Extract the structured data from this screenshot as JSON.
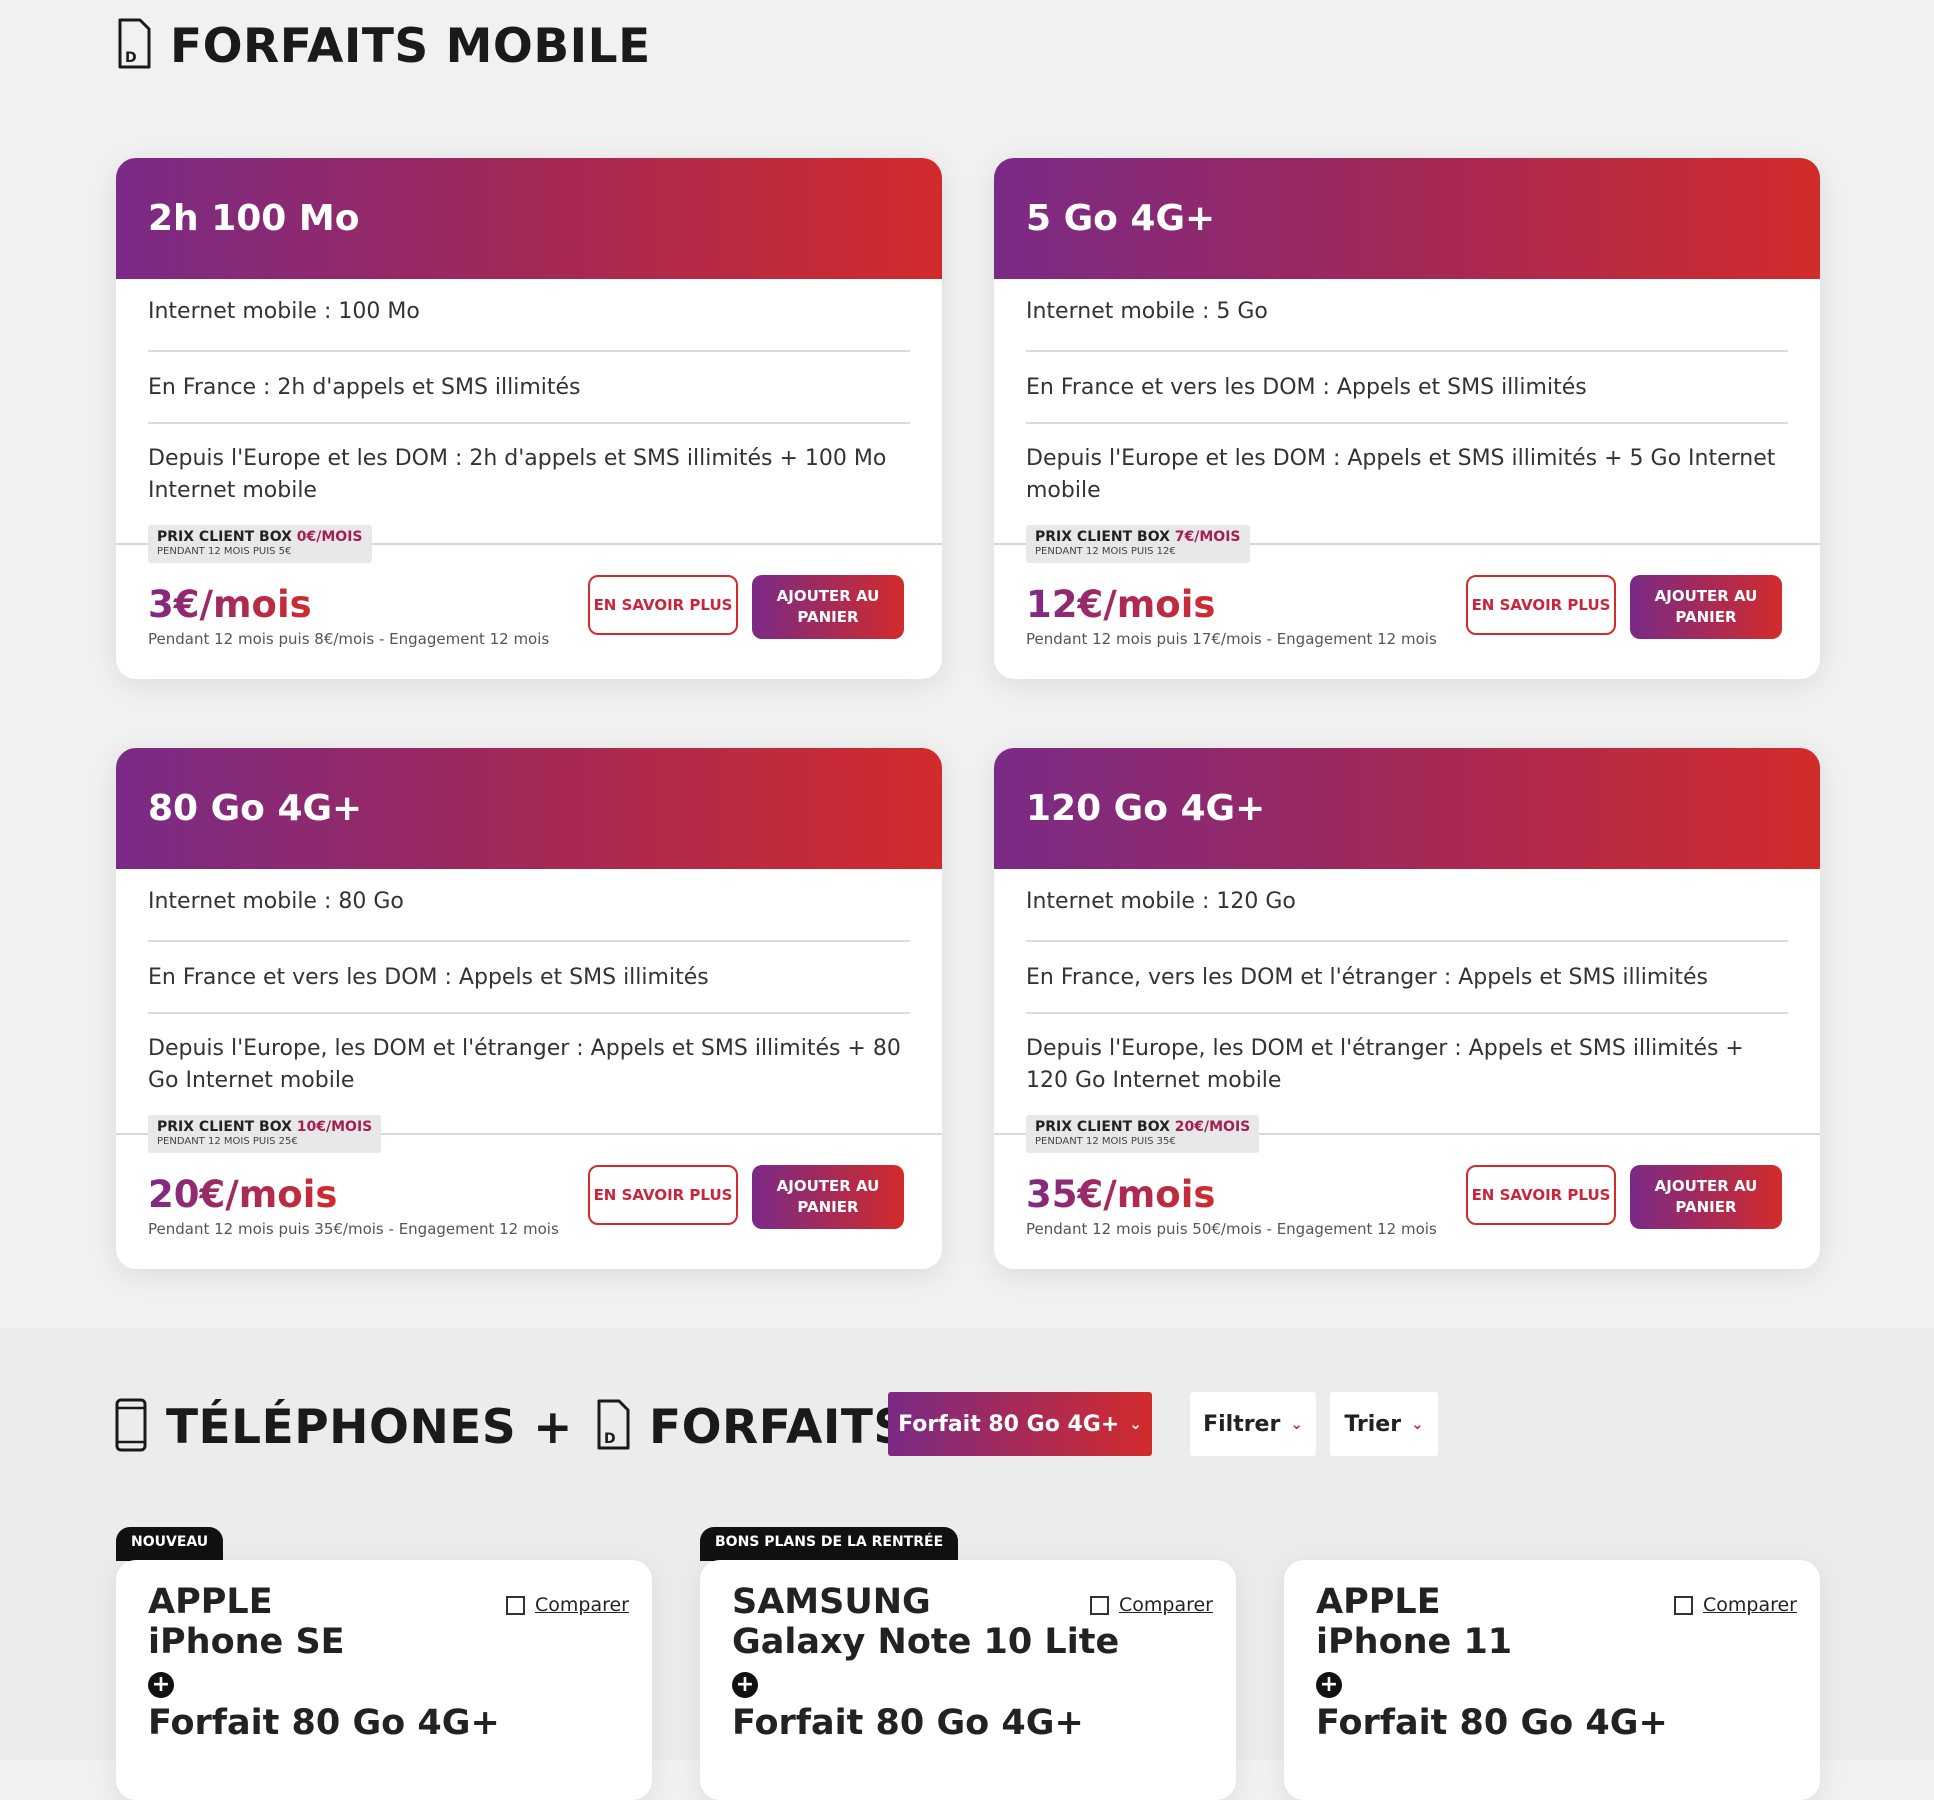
{
  "section_mobile": {
    "title": "FORFAITS MOBILE"
  },
  "plans": [
    {
      "name": "2h 100 Mo",
      "feature1": "Internet mobile : 100 Mo",
      "feature2": "En France : 2h d'appels et SMS illimités",
      "feature3": "Depuis l'Europe et les DOM : 2h d'appels et SMS illimités + 100 Mo Internet mobile",
      "box_label": "PRIX CLIENT BOX",
      "box_price": "0€/MOIS",
      "box_sub": "PENDANT 12 MOIS PUIS 5€",
      "price": "3€/mois",
      "price_sub": "Pendant 12 mois puis 8€/mois - Engagement 12 mois",
      "more_label": "EN SAVOIR PLUS",
      "add_label": "AJOUTER AU PANIER"
    },
    {
      "name": "5 Go 4G+",
      "feature1": "Internet mobile : 5 Go",
      "feature2": "En France et vers les DOM : Appels et SMS illimités",
      "feature3": "Depuis l'Europe et les DOM : Appels et SMS illimités + 5 Go Internet mobile",
      "box_label": "PRIX CLIENT BOX",
      "box_price": "7€/MOIS",
      "box_sub": "PENDANT 12 MOIS PUIS 12€",
      "price": "12€/mois",
      "price_sub": "Pendant 12 mois puis 17€/mois - Engagement 12 mois",
      "more_label": "EN SAVOIR PLUS",
      "add_label": "AJOUTER AU PANIER"
    },
    {
      "name": "80 Go 4G+",
      "feature1": "Internet mobile : 80 Go",
      "feature2": "En France et vers les DOM : Appels et SMS illimités",
      "feature3": "Depuis l'Europe, les DOM et l'étranger : Appels et SMS illimités + 80 Go Internet mobile",
      "box_label": "PRIX CLIENT BOX",
      "box_price": "10€/MOIS",
      "box_sub": "PENDANT 12 MOIS PUIS 25€",
      "price": "20€/mois",
      "price_sub": "Pendant 12 mois puis 35€/mois - Engagement 12 mois",
      "more_label": "EN SAVOIR PLUS",
      "add_label": "AJOUTER AU PANIER"
    },
    {
      "name": "120 Go 4G+",
      "feature1": "Internet mobile : 120 Go",
      "feature2": "En France, vers les DOM et l'étranger : Appels et SMS illimités",
      "feature3": "Depuis l'Europe, les DOM et l'étranger : Appels et SMS illimités + 120 Go Internet mobile",
      "box_label": "PRIX CLIENT BOX",
      "box_price": "20€/MOIS",
      "box_sub": "PENDANT 12 MOIS PUIS 35€",
      "price": "35€/mois",
      "price_sub": "Pendant 12 mois puis 50€/mois - Engagement 12 mois",
      "more_label": "EN SAVOIR PLUS",
      "add_label": "AJOUTER AU PANIER"
    }
  ],
  "section_phones": {
    "title_part1": "TÉLÉPHONES +",
    "title_part2": "FORFAITS"
  },
  "filters": {
    "plan_selected": "Forfait 80 Go 4G+",
    "filter_label": "Filtrer",
    "sort_label": "Trier"
  },
  "phones": [
    {
      "tag": "NOUVEAU",
      "brand": "APPLE",
      "model": "iPhone SE",
      "plan": "Forfait 80 Go 4G+",
      "compare_label": "Comparer"
    },
    {
      "tag": "BONS PLANS DE LA RENTRÉE",
      "brand": "SAMSUNG",
      "model": "Galaxy Note 10 Lite",
      "plan": "Forfait 80 Go 4G+",
      "compare_label": "Comparer"
    },
    {
      "brand": "APPLE",
      "model": "iPhone 11",
      "plan": "Forfait 80 Go 4G+",
      "compare_label": "Comparer"
    }
  ],
  "colors": {
    "gradient_start": "#7a2a86",
    "gradient_end": "#d22b2b",
    "page_bg": "#f1f1f1"
  }
}
